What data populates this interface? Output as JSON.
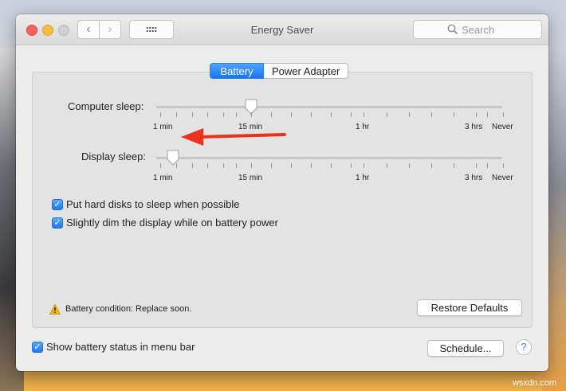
{
  "window": {
    "title": "Energy Saver"
  },
  "toolbar": {
    "back": "‹",
    "forward": "›",
    "search_placeholder": "Search"
  },
  "tabs": [
    {
      "label": "Battery",
      "selected": true
    },
    {
      "label": "Power Adapter",
      "selected": false
    }
  ],
  "computer_sleep": {
    "label": "Computer sleep:",
    "value": "15 min",
    "scale_labels": [
      "1 min",
      "15 min",
      "1 hr",
      "3 hrs",
      "Never"
    ]
  },
  "display_sleep": {
    "label": "Display sleep:",
    "value": "2 min",
    "scale_labels": [
      "1 min",
      "15 min",
      "1 hr",
      "3 hrs",
      "Never"
    ]
  },
  "options": [
    {
      "label": "Put hard disks to sleep when possible",
      "checked": true
    },
    {
      "label": "Slightly dim the display while on battery power",
      "checked": true
    }
  ],
  "status": {
    "battery_condition": "Battery condition: Replace soon."
  },
  "buttons": {
    "restore_defaults": "Restore Defaults",
    "schedule": "Schedule...",
    "help": "?"
  },
  "footer": {
    "show_battery_status": {
      "label": "Show battery status in menu bar",
      "checked": true
    }
  },
  "annotation": {
    "arrow_color": "#e8321e"
  },
  "accent_color": "#1c78f2",
  "watermark": "wsxdn.com"
}
